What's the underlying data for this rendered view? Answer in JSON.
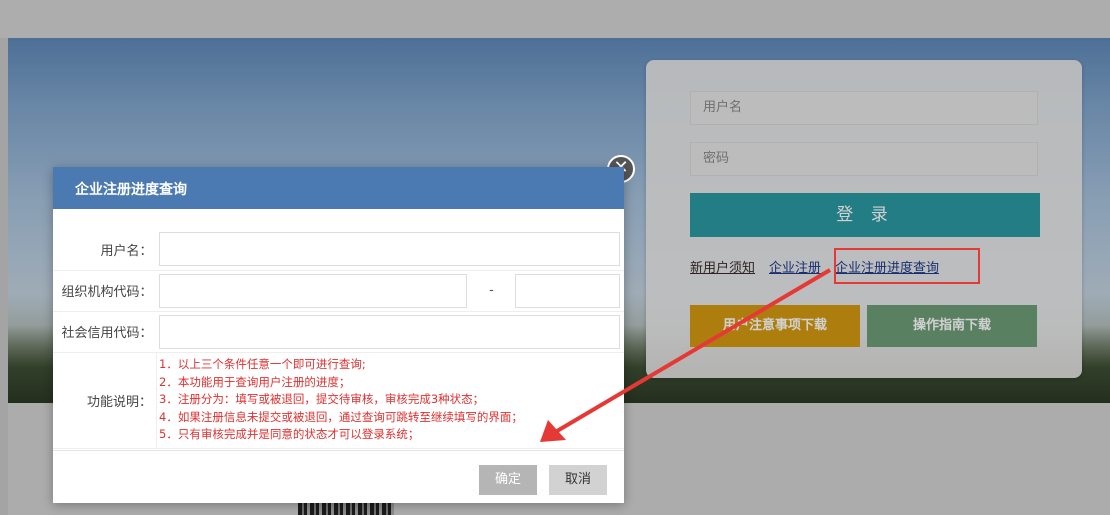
{
  "login": {
    "username_placeholder": "用户名",
    "password_placeholder": "密码",
    "login_label": "登 录",
    "links": [
      "新用户须知",
      "企业注册",
      "企业注册进度查询"
    ],
    "download_notice_label": "用户注意事项下载",
    "download_guide_label": "操作指南下载"
  },
  "dialog": {
    "title": "企业注册进度查询",
    "close_symbol": "✕",
    "fields": {
      "username_label": "用户名：",
      "org_code_label": "组织机构代码：",
      "org_code_separator": "-",
      "credit_code_label": "社会信用代码：",
      "description_label": "功能说明："
    },
    "notes": [
      "1．以上三个条件任意一个即可进行查询;",
      "2．本功能用于查询用户注册的进度；",
      "3．注册分为：填写或被退回，提交待审核，审核完成3种状态；",
      "4．如果注册信息未提交或被退回，通过查询可跳转至继续填写的界面；",
      "5．只有审核完成并是同意的状态才可以登录系统；"
    ],
    "ok_label": "确定",
    "cancel_label": "取消"
  },
  "colors": {
    "dialog_header": "#4a7ab1",
    "login_button": "#2a99a3",
    "download_notice": "#d49a12",
    "download_guide": "#6e9d78",
    "annotation_red": "#e53935",
    "notes_text": "#e03030"
  },
  "icons": {
    "close": "close-circle-icon",
    "annotation": "annotation-arrow-icon"
  }
}
